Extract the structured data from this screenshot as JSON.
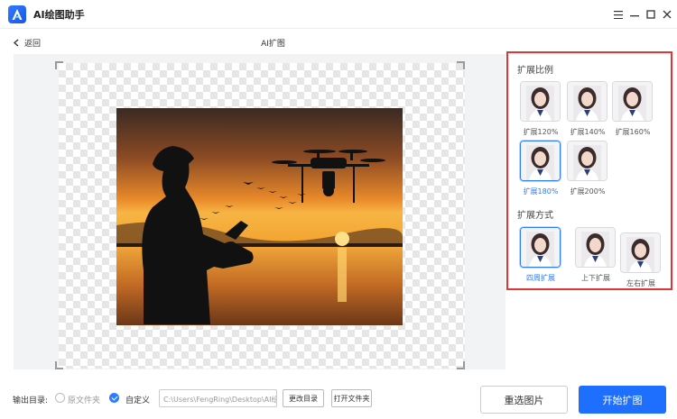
{
  "app": {
    "title": "AI绘图助手"
  },
  "window_controls": [
    "menu-icon",
    "minimize-icon",
    "maximize-icon",
    "close-icon"
  ],
  "subbar": {
    "back_label": "返回",
    "page_title": "AI扩图"
  },
  "panel": {
    "ratio_title": "扩展比例",
    "ratios": [
      {
        "label": "扩展120%",
        "selected": false
      },
      {
        "label": "扩展140%",
        "selected": false
      },
      {
        "label": "扩展160%",
        "selected": false
      },
      {
        "label": "扩展180%",
        "selected": true
      },
      {
        "label": "扩展200%",
        "selected": false
      }
    ],
    "mode_title": "扩展方式",
    "modes": [
      {
        "label": "四周扩展",
        "selected": true
      },
      {
        "label": "上下扩展",
        "selected": false
      },
      {
        "label": "左右扩展",
        "selected": false
      }
    ]
  },
  "bottom": {
    "output_label": "输出目录:",
    "opt_original": "原文件夹",
    "opt_custom": "自定义",
    "path_value": "C:\\Users\\FengRing\\Desktop\\AI绘",
    "change_dir": "更改目录",
    "open_folder": "打开文件夹",
    "reselect": "重选图片",
    "start": "开始扩图"
  },
  "colors": {
    "accent": "#2f7bff",
    "highlight_box": "#e53434",
    "primary_btn": "#1f6fff"
  }
}
